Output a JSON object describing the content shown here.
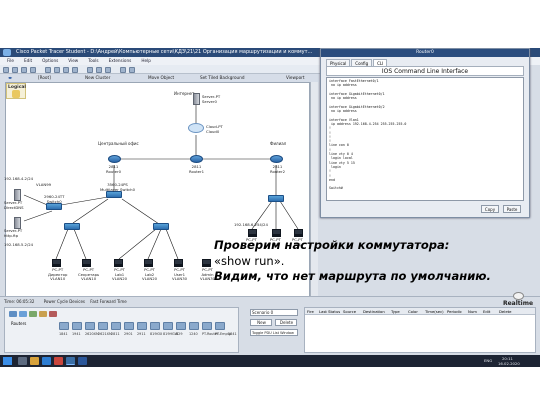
{
  "app": {
    "title": "Cisco Packet Tracer Student - D:\\Андрей\\Компьютерные сети\\КДЗ\\21\\21 Организация маршрутизации и коммут...",
    "menu": [
      "File",
      "Edit",
      "Options",
      "View",
      "Tools",
      "Extensions",
      "Help"
    ],
    "workspace_bar": {
      "root": "[Root]",
      "new_cluster": "New Cluster",
      "move_object": "Move Object",
      "set_tiled": "Set Tiled Background",
      "viewport": "Viewport"
    },
    "logical_tab": "Logical"
  },
  "topology": {
    "zones": {
      "central": "Центральный офис",
      "branch": "Филиал",
      "internet": "Интернет"
    },
    "nodes": {
      "server_internet": "Server-PT\nServer0",
      "cloud": "Cloud-PT\nCloud0",
      "router_central": "2811\nRouter0",
      "router_internet": "2811\nRouter1",
      "router_branch": "2811\nRouter2",
      "switch0": "2960-24TT\nSwitch0",
      "switch_multilayer": "3560-24PS\nMultilayer Switch0",
      "switch1": "2960-24TT\nSwitch1",
      "switch2": "2960-24TT\nSwitch2",
      "server_dns": "Server-PT\nDirectDNS",
      "server_http": "Server-PT\nhttp.ftp",
      "pc_dir": "PC-PT\nДиректор\nVLAN10",
      "pc_sec": "PC-PT\nСекретарь\nVLAN10",
      "pc_lab1": "PC-PT\nLab1\nVLAN20",
      "pc_lab2": "PC-PT\nLab2\nVLAN20",
      "pc_user1": "PC-PT\nUser1\nVLAN30",
      "pc_admin": "PC-PT\nAdmin\nVLAN30",
      "pc_b1": "PC-PT\nPC2",
      "pc_b2": "PC-PT\nPC3",
      "pc_b3": "PC-PT\nPC1",
      "lbl_net1": "192.168.4.2/24",
      "lbl_net2": "192.168.5.2/24",
      "lbl_net3": "192.168.6.254/24",
      "lbl_vlan": "VLAN99"
    }
  },
  "cli_window": {
    "title": "Router0",
    "tabs": [
      "Physical",
      "Config",
      "CLI"
    ],
    "active_tab": "CLI",
    "heading": "IOS Command Line Interface",
    "lines": [
      "interface FastEthernet0/1",
      " no ip address",
      "",
      "interface GigabitEthernet0/1",
      " no ip address",
      "",
      "interface GigabitEthernet0/2",
      " no ip address",
      "",
      "interface Vlan1",
      " ip address 192.168.4.254 255.255.255.0",
      "!",
      "!",
      "!",
      "!",
      "line con 0",
      "!",
      "line vty 0 4",
      " login local",
      "line vty 5 15",
      " login",
      "!",
      "!",
      "end",
      "",
      "Switch#"
    ],
    "copy_label": "Copy",
    "paste_label": "Paste"
  },
  "caption": {
    "line1": "Проверим настройки коммутатора:",
    "line2": "«show run».",
    "line3": "Видим, что нет маршрута по умолчанию."
  },
  "realtime": "Realtime",
  "bottom": {
    "time": "Time: 06:05:32",
    "power_cycle": "Power Cycle Devices",
    "fast_forward": "Fast Forward Time",
    "device_category": "Routers",
    "device_models": [
      "1841",
      "1941",
      "2620XM",
      "2621XM",
      "2811",
      "2901",
      "2911",
      "819IOX",
      "819HGW",
      "829",
      "1240",
      "PT-Router",
      "PT-Empty",
      "1841"
    ],
    "scenario": "Scenario 0",
    "new_label": "New",
    "delete_label": "Delete",
    "toggle_pdu": "Toggle PDU List Window",
    "pdu_columns": [
      "Fire",
      "Last Status",
      "Source",
      "Destination",
      "Type",
      "Color",
      "Time(sec)",
      "Periodic",
      "Num",
      "Edit",
      "Delete"
    ]
  },
  "taskbar": {
    "lang": "ENG",
    "time": "20:11",
    "date": "16.02.2020"
  }
}
